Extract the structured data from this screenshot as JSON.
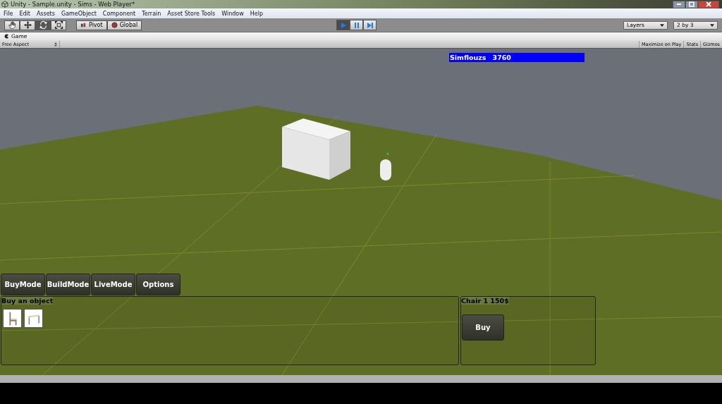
{
  "window": {
    "title": "Unity - Sample.unity - Sims - Web Player*"
  },
  "menu": [
    "File",
    "Edit",
    "Assets",
    "GameObject",
    "Component",
    "Terrain",
    "Asset Store Tools",
    "Window",
    "Help"
  ],
  "tools": [
    {
      "kind": "hand",
      "selected": false
    },
    {
      "kind": "move",
      "selected": false
    },
    {
      "kind": "rotate",
      "selected": true
    },
    {
      "kind": "scale",
      "selected": false
    }
  ],
  "handle_buttons": [
    {
      "kind": "pivot",
      "label": "Pivot"
    },
    {
      "kind": "global",
      "label": "Global"
    }
  ],
  "play_controls": [
    {
      "kind": "play",
      "selected": true
    },
    {
      "kind": "pause",
      "selected": false
    },
    {
      "kind": "step",
      "selected": false
    }
  ],
  "dropdowns": [
    {
      "label": "Layers"
    },
    {
      "label": "2 by 3"
    }
  ],
  "game_tab": {
    "label": "Game"
  },
  "game_toolbar": {
    "aspect": "Free Aspect",
    "buttons": [
      "Maximize on Play",
      "Stats",
      "Gizmos"
    ]
  },
  "hud": {
    "money_label": "Simflouzs",
    "money_value": "3760"
  },
  "modes": [
    "BuyMode",
    "BuildMode",
    "LiveMode",
    "Options"
  ],
  "buy_panel": {
    "title": "Buy an object",
    "items": [
      {
        "kind": "chair"
      },
      {
        "kind": "table"
      }
    ]
  },
  "detail_panel": {
    "title": "Chair 1  150$",
    "button": "Buy"
  }
}
